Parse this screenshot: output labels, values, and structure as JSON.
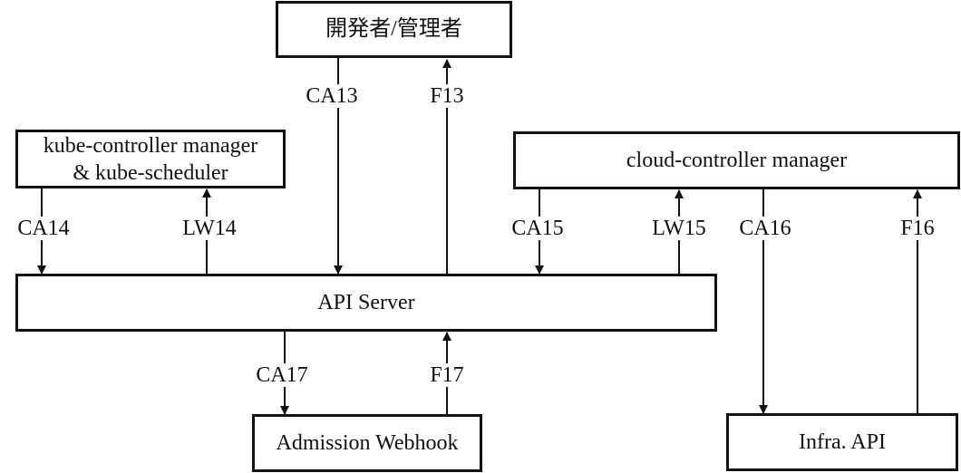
{
  "nodes": {
    "developer": {
      "label": "開発者/管理者"
    },
    "kcm": {
      "line1": "kube-controller manager",
      "line2": "& kube-scheduler"
    },
    "ccm": {
      "label": "cloud-controller manager"
    },
    "api_server": {
      "label": "API Server"
    },
    "admission": {
      "label": "Admission Webhook"
    },
    "infra": {
      "label": "Infra. API"
    }
  },
  "edges": {
    "ca13": {
      "label": "CA13",
      "from": "開発者/管理者",
      "to": "API Server"
    },
    "f13": {
      "label": "F13",
      "from": "API Server",
      "to": "開発者/管理者"
    },
    "ca14": {
      "label": "CA14",
      "from": "kube-controller manager",
      "to": "API Server"
    },
    "lw14": {
      "label": "LW14",
      "from": "API Server",
      "to": "kube-controller manager"
    },
    "ca15": {
      "label": "CA15",
      "from": "cloud-controller manager",
      "to": "API Server"
    },
    "lw15": {
      "label": "LW15",
      "from": "API Server",
      "to": "cloud-controller manager"
    },
    "ca16": {
      "label": "CA16",
      "from": "cloud-controller manager",
      "to": "Infra. API"
    },
    "f16": {
      "label": "F16",
      "from": "Infra. API",
      "to": "cloud-controller manager"
    },
    "ca17": {
      "label": "CA17",
      "from": "API Server",
      "to": "Admission Webhook"
    },
    "f17": {
      "label": "F17",
      "from": "Admission Webhook",
      "to": "API Server"
    }
  },
  "colors": {
    "line": "#111111",
    "background": "#ffffff"
  }
}
